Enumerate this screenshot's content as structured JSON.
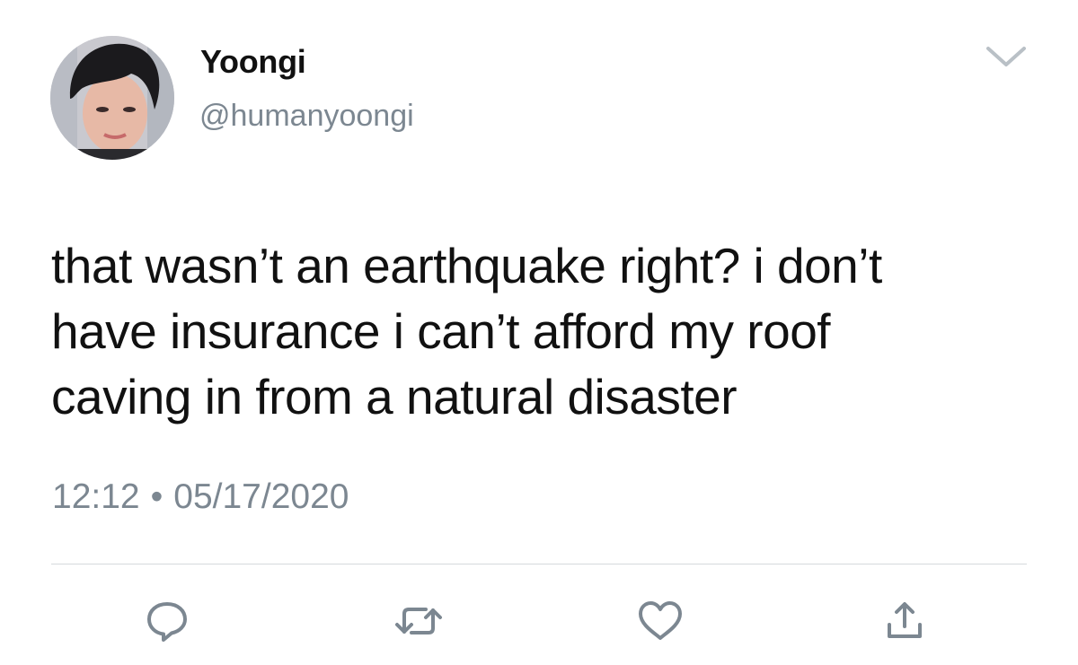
{
  "user": {
    "display_name": "Yoongi",
    "handle": "@humanyoongi",
    "avatar_icon": "profile-photo"
  },
  "tweet": {
    "lines": [
      "that wasn’t an earthquake right? i don’t",
      "have insurance i can’t afford my roof",
      "caving in from a natural disaster"
    ],
    "time": "12:12",
    "separator": "•",
    "date": "05/17/2020"
  },
  "actions": {
    "reply_icon": "reply-icon",
    "retweet_icon": "retweet-icon",
    "like_icon": "heart-icon",
    "share_icon": "share-icon",
    "menu_icon": "chevron-down-icon"
  },
  "colors": {
    "text": "#111111",
    "secondary": "#7c8791",
    "divider": "#d5d9dd",
    "icon": "#7c8791"
  }
}
